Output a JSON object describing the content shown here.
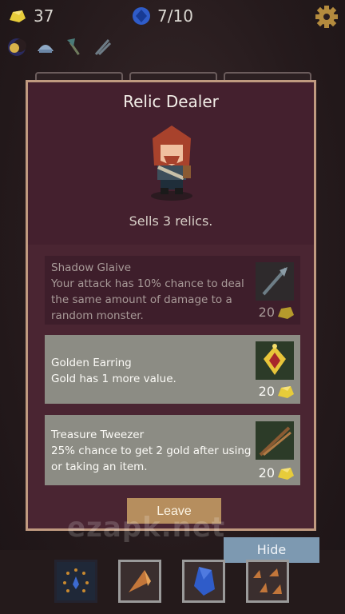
{
  "status": {
    "gold": "37",
    "gems": "7/10",
    "settings_icon": "gear-icon"
  },
  "relics_owned": [
    "moon-icon",
    "helmet-icon",
    "axe-icon",
    "claw-icon"
  ],
  "dialog": {
    "title": "Relic Dealer",
    "subtitle": "Sells 3 relics.",
    "items": [
      {
        "name": "Shadow Glaive",
        "description": "Your attack has 10% chance to deal the same amount of damage to a random monster.",
        "price": "20",
        "icon": "shadow-glaive-icon",
        "sold": true
      },
      {
        "name": "Golden Earring",
        "description": "Gold has 1 more value.",
        "price": "20",
        "icon": "golden-earring-icon",
        "sold": false
      },
      {
        "name": "Treasure Tweezer",
        "description": "25% chance to get 2 gold after using or taking an item.",
        "price": "20",
        "icon": "tweezer-icon",
        "sold": false
      }
    ],
    "leave_label": "Leave"
  },
  "watermark": "ezapk.net",
  "hide_label": "Hide",
  "hand": [
    "droplets-card-icon",
    "claw-card-icon",
    "gem-card-icon",
    "claws-card-icon"
  ],
  "colors": {
    "panel_bg": "#4a2532",
    "panel_border": "#c09a80",
    "card_bg": "#8c8c84",
    "leave_button": "#b68e5e",
    "hide_button": "#7d99b1",
    "gold": "#e7cc3a"
  }
}
